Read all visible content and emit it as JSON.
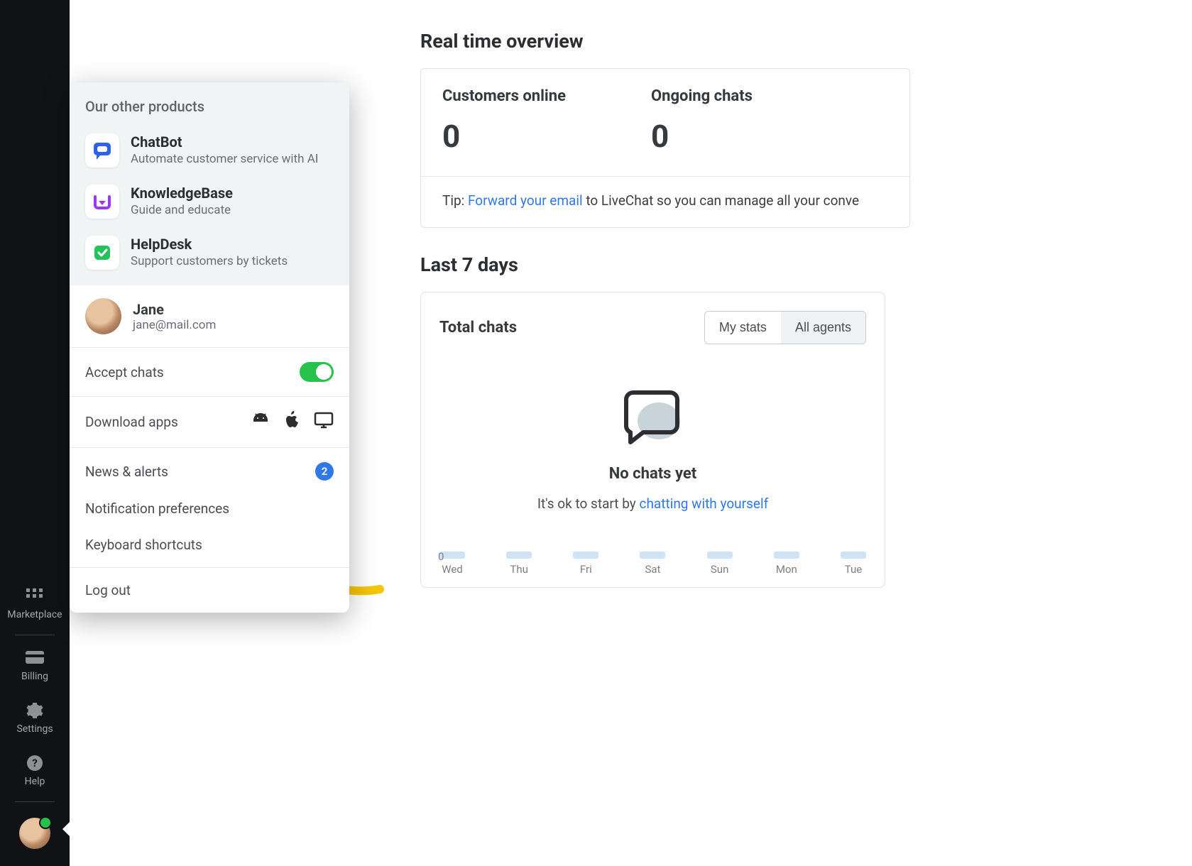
{
  "rail": {
    "items": [
      {
        "label": "Marketplace"
      },
      {
        "label": "Billing"
      },
      {
        "label": "Settings"
      },
      {
        "label": "Help"
      }
    ]
  },
  "popup": {
    "header": "Our other products",
    "products": [
      {
        "title": "ChatBot",
        "desc": "Automate customer service with AI",
        "icon": "chatbot"
      },
      {
        "title": "KnowledgeBase",
        "desc": "Guide and educate",
        "icon": "knowledgebase"
      },
      {
        "title": "HelpDesk",
        "desc": "Support customers by tickets",
        "icon": "helpdesk"
      }
    ],
    "user": {
      "name": "Jane",
      "email": "jane@mail.com"
    },
    "accept_chats_label": "Accept chats",
    "accept_chats_on": true,
    "download_label": "Download apps",
    "links": {
      "news": "News & alerts",
      "news_badge": "2",
      "notif": "Notification preferences",
      "shortcuts": "Keyboard shortcuts"
    },
    "logout": "Log out"
  },
  "overview": {
    "title": "Real time overview",
    "customers_label": "Customers online",
    "customers_value": "0",
    "ongoing_label": "Ongoing chats",
    "ongoing_value": "0",
    "tip_prefix": "Tip: ",
    "tip_link": "Forward your email",
    "tip_suffix": " to LiveChat so you can manage all your conve"
  },
  "last7": {
    "title": "Last 7 days",
    "total_label": "Total chats",
    "seg_my": "My stats",
    "seg_all": "All agents",
    "empty_title": "No chats yet",
    "empty_prefix": "It's ok to start by ",
    "empty_link": "chatting with yourself",
    "y0": "0",
    "days": [
      "Wed",
      "Thu",
      "Fri",
      "Sat",
      "Sun",
      "Mon",
      "Tue"
    ]
  },
  "chart_data": {
    "type": "bar",
    "categories": [
      "Wed",
      "Thu",
      "Fri",
      "Sat",
      "Sun",
      "Mon",
      "Tue"
    ],
    "values": [
      0,
      0,
      0,
      0,
      0,
      0,
      0
    ],
    "title": "Total chats",
    "xlabel": "",
    "ylabel": "",
    "ylim": [
      0,
      1
    ]
  },
  "colors": {
    "accent": "#2f78e6",
    "green": "#27c24c",
    "yellow": "#f7c500"
  }
}
